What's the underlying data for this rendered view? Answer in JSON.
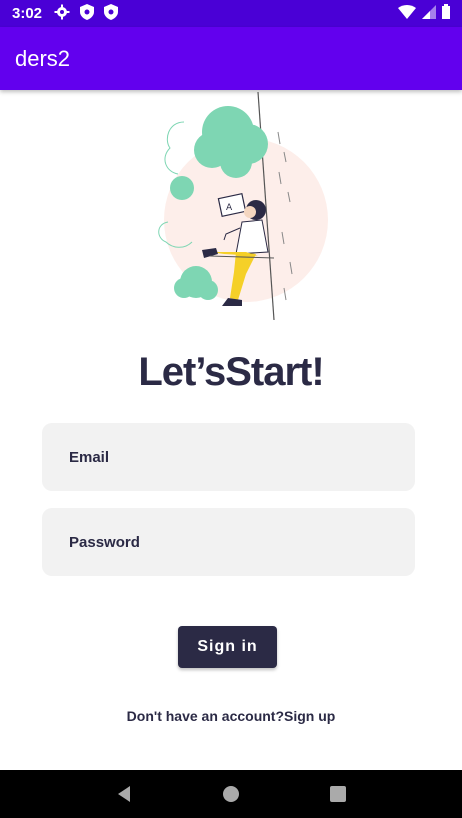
{
  "status_bar": {
    "time": "3:02",
    "icons_left": [
      "gear-icon",
      "shield-icon",
      "shield-icon"
    ],
    "icons_right": [
      "wifi-icon",
      "signal-icon",
      "battery-icon"
    ]
  },
  "app_bar": {
    "title": "ders2",
    "color": "#6200ee"
  },
  "main": {
    "illustration": "woman-with-laptop-illustration",
    "headline": "Let’sStart!",
    "email_placeholder": "Email",
    "password_placeholder": "Password",
    "signin_label": "Sign in",
    "signup_prompt": "Don't have an account?",
    "signup_link": "Sign up"
  },
  "nav_bar": {
    "buttons": [
      "back-icon",
      "home-icon",
      "recents-icon"
    ]
  }
}
